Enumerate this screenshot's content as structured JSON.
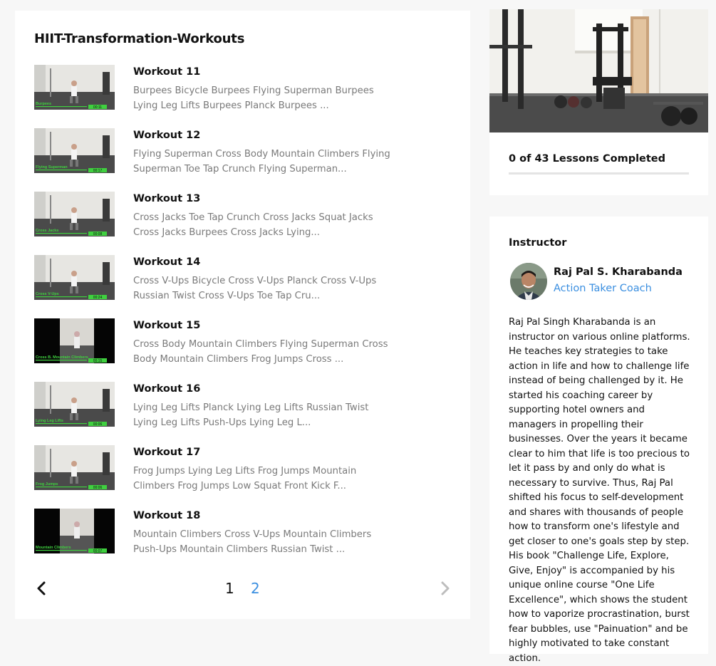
{
  "course": {
    "title": "HIIT-Transformation-Workouts",
    "lessons": [
      {
        "title": "Workout 11",
        "description": "Burpees Bicycle Burpees Flying Superman Burpees Lying Leg Lifts Burpees Planck Burpees ...",
        "thumb_label": "Burpees",
        "thumb_time": "00:11",
        "thumb_style": "light"
      },
      {
        "title": "Workout 12",
        "description": "Flying Superman Cross Body Mountain Climbers Flying Superman Toe Tap Crunch Flying Superman...",
        "thumb_label": "Flying Superman",
        "thumb_time": "00:17",
        "thumb_style": "light"
      },
      {
        "title": "Workout 13",
        "description": "Cross Jacks Toe Tap Crunch Cross Jacks Squat Jacks Cross Jacks Burpees Cross Jacks Lying...",
        "thumb_label": "Cross Jacks",
        "thumb_time": "00:08",
        "thumb_style": "light"
      },
      {
        "title": "Workout 14",
        "description": "Cross V-Ups Bicycle Cross V-Ups Planck Cross V-Ups Russian Twist Cross V-Ups Toe Tap Cru...",
        "thumb_label": "Cross V-Ups",
        "thumb_time": "00:24",
        "thumb_style": "light"
      },
      {
        "title": "Workout 15",
        "description": "Cross Body Mountain Climbers Flying Superman Cross Body Mountain Climbers Frog Jumps Cross ...",
        "thumb_label": "Cross B. Mountain Climbers",
        "thumb_time": "00:15",
        "thumb_style": "dark"
      },
      {
        "title": "Workout 16",
        "description": "Lying Leg Lifts Planck Lying Leg Lifts Russian Twist Lying Leg Lifts Push-Ups Lying Leg L...",
        "thumb_label": "Lying Leg Lifts",
        "thumb_time": "00:06",
        "thumb_style": "light"
      },
      {
        "title": "Workout 17",
        "description": "Frog Jumps Lying Leg Lifts Frog Jumps Mountain Climbers Frog Jumps Low Squat Front Kick F...",
        "thumb_label": "Frog Jumps",
        "thumb_time": "00:06",
        "thumb_style": "light"
      },
      {
        "title": "Workout 18",
        "description": "Mountain Climbers Cross V-Ups Mountain Climbers Push-Ups Mountain Climbers Russian Twist ...",
        "thumb_label": "Mountain Climbers",
        "thumb_time": "00:07",
        "thumb_style": "dark"
      }
    ]
  },
  "pagination": {
    "pages": [
      "1",
      "2"
    ],
    "current": "1",
    "prev_icon": "chevron-left-icon",
    "next_icon": "chevron-right-icon"
  },
  "progress": {
    "text": "0 of 43 Lessons Completed",
    "completed": 0,
    "total": 43
  },
  "instructor": {
    "heading": "Instructor",
    "name": "Raj Pal S. Kharabanda",
    "role": "Action Taker Coach",
    "bio": "Raj Pal Singh Kharabanda is an instructor on various online platforms. He teaches key strategies to take action in life and how to challenge life instead of being challenged by it. He started his coaching career by supporting hotel owners and managers in propelling their businesses. Over the years it became clear to him that life is too precious to let it pass by and only do what is necessary to survive. Thus, Raj Pal shifted his focus to self-development and shares with thousands of people how to transform one's lifestyle and get closer to one's goals step by step. His book \"Challenge Life, Explore, Give, Enjoy\" is accompanied by his unique online course \"One Life Excellence\", which shows the student how to vaporize procrastination, burst fear bubbles, use \"Painuation\" and be highly motivated to take constant action."
  },
  "colors": {
    "accent": "#3b8fe0",
    "background": "#f7f7f7",
    "card": "#ffffff",
    "thumb_label": "#3fd03f"
  }
}
